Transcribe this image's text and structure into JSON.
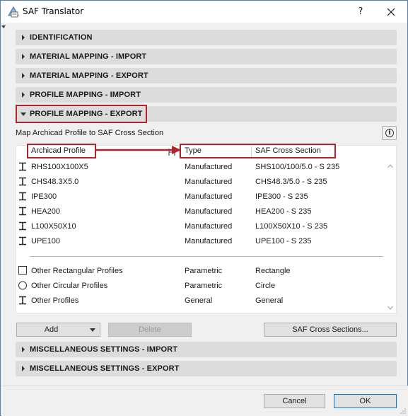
{
  "window": {
    "title": "SAF Translator",
    "help_glyph": "?",
    "icon": "saf-app-icon"
  },
  "sections": [
    {
      "label": "IDENTIFICATION",
      "expanded": false
    },
    {
      "label": "MATERIAL MAPPING - IMPORT",
      "expanded": false
    },
    {
      "label": "MATERIAL MAPPING - EXPORT",
      "expanded": false
    },
    {
      "label": "PROFILE MAPPING - IMPORT",
      "expanded": false
    },
    {
      "label": "PROFILE MAPPING - EXPORT",
      "expanded": true
    },
    {
      "label": "MISCELLANEOUS SETTINGS - IMPORT",
      "expanded": false
    },
    {
      "label": "MISCELLANEOUS SETTINGS - EXPORT",
      "expanded": false
    }
  ],
  "profile_export": {
    "subtitle": "Map Archicad Profile to SAF Cross Section",
    "columns": {
      "profile": "Archicad Profile",
      "type": "Type",
      "section": "SAF Cross Section"
    },
    "rows": [
      {
        "profile": "RHS100X100X5",
        "type": "Manufactured",
        "section": "SHS100/100/5.0 - S 235",
        "icon": "i-beam-icon"
      },
      {
        "profile": "CHS48.3X5.0",
        "type": "Manufactured",
        "section": "CHS48.3/5.0 - S 235",
        "icon": "i-beam-icon"
      },
      {
        "profile": "IPE300",
        "type": "Manufactured",
        "section": "IPE300 - S 235",
        "icon": "i-beam-icon"
      },
      {
        "profile": "HEA200",
        "type": "Manufactured",
        "section": "HEA200 - S 235",
        "icon": "i-beam-icon"
      },
      {
        "profile": "L100X50X10",
        "type": "Manufactured",
        "section": "L100X50X10 - S 235",
        "icon": "i-beam-icon"
      },
      {
        "profile": "UPE100",
        "type": "Manufactured",
        "section": "UPE100 - S 235",
        "icon": "i-beam-icon"
      }
    ],
    "other_rows": [
      {
        "profile": "Other Rectangular Profiles",
        "type": "Parametric",
        "section": "Rectangle",
        "icon": "square-icon"
      },
      {
        "profile": "Other Circular Profiles",
        "type": "Parametric",
        "section": "Circle",
        "icon": "circle-icon"
      },
      {
        "profile": "Other Profiles",
        "type": "General",
        "section": "General",
        "icon": "i-beam-icon"
      }
    ],
    "add_label": "Add",
    "delete_label": "Delete",
    "saf_sections_label": "SAF Cross Sections..."
  },
  "footer": {
    "cancel_label": "Cancel",
    "ok_label": "OK"
  },
  "colors": {
    "highlight": "#b0242c",
    "section_bg": "#dcdcdc",
    "primary_border": "#0078d7"
  }
}
